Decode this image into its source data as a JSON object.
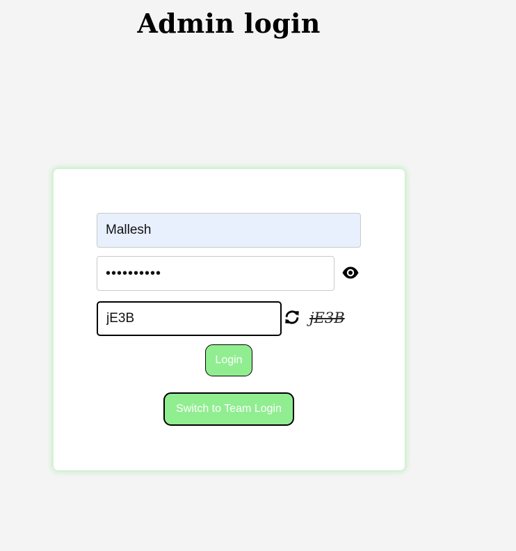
{
  "page": {
    "title": "Admin login"
  },
  "form": {
    "username": {
      "value": "Mallesh"
    },
    "password": {
      "value": "••••••••••"
    },
    "captcha": {
      "input_value": "jE3B",
      "challenge_text": "jE3B"
    },
    "login_label": "Login",
    "switch_label": "Switch to Team Login"
  },
  "icons": {
    "password_toggle": "eye-icon",
    "captcha_refresh": "refresh-icon"
  },
  "colors": {
    "page_background": "#f4f4f4",
    "card_background": "#ffffff",
    "card_glow": "#90ee90",
    "button_background": "#90ee90",
    "button_text": "#ffffff",
    "username_autofill_background": "#e8f0fe"
  }
}
